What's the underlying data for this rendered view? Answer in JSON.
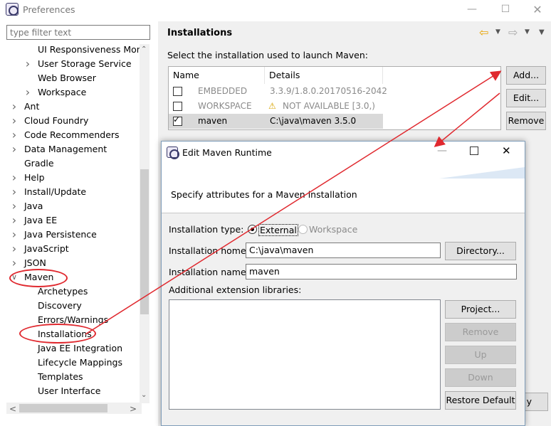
{
  "window": {
    "title": "Preferences"
  },
  "filter": {
    "placeholder": "type filter text"
  },
  "tree": [
    {
      "label": "UI Responsiveness Moni",
      "indent": 2,
      "chevron": ""
    },
    {
      "label": "User Storage Service",
      "indent": 2,
      "chevron": ">"
    },
    {
      "label": "Web Browser",
      "indent": 2,
      "chevron": ""
    },
    {
      "label": "Workspace",
      "indent": 2,
      "chevron": ">"
    },
    {
      "label": "Ant",
      "indent": 1,
      "chevron": ">"
    },
    {
      "label": "Cloud Foundry",
      "indent": 1,
      "chevron": ">"
    },
    {
      "label": "Code Recommenders",
      "indent": 1,
      "chevron": ">"
    },
    {
      "label": "Data Management",
      "indent": 1,
      "chevron": ">"
    },
    {
      "label": "Gradle",
      "indent": 1,
      "chevron": ""
    },
    {
      "label": "Help",
      "indent": 1,
      "chevron": ">"
    },
    {
      "label": "Install/Update",
      "indent": 1,
      "chevron": ">"
    },
    {
      "label": "Java",
      "indent": 1,
      "chevron": ">"
    },
    {
      "label": "Java EE",
      "indent": 1,
      "chevron": ">"
    },
    {
      "label": "Java Persistence",
      "indent": 1,
      "chevron": ">"
    },
    {
      "label": "JavaScript",
      "indent": 1,
      "chevron": ">"
    },
    {
      "label": "JSON",
      "indent": 1,
      "chevron": ">"
    },
    {
      "label": "Maven",
      "indent": 1,
      "chevron": "v"
    },
    {
      "label": "Archetypes",
      "indent": 2,
      "chevron": ""
    },
    {
      "label": "Discovery",
      "indent": 2,
      "chevron": ""
    },
    {
      "label": "Errors/Warnings",
      "indent": 2,
      "chevron": ""
    },
    {
      "label": "Installations",
      "indent": 2,
      "chevron": ""
    },
    {
      "label": "Java EE Integration",
      "indent": 2,
      "chevron": ""
    },
    {
      "label": "Lifecycle Mappings",
      "indent": 2,
      "chevron": ""
    },
    {
      "label": "Templates",
      "indent": 2,
      "chevron": ""
    },
    {
      "label": "User Interface",
      "indent": 2,
      "chevron": ""
    }
  ],
  "installations": {
    "title": "Installations",
    "subtitle": "Select the installation used to launch Maven:",
    "columns": [
      "Name",
      "Details"
    ],
    "rows": [
      {
        "name": "EMBEDDED",
        "details": "3.3.9/1.8.0.20170516-2042",
        "checked": false,
        "dim": true,
        "warn": false
      },
      {
        "name": "WORKSPACE",
        "details": "NOT AVAILABLE [3.0,)",
        "checked": false,
        "dim": true,
        "warn": true
      },
      {
        "name": "maven",
        "details": "C:\\java\\maven 3.5.0",
        "checked": true,
        "dim": false,
        "warn": false
      }
    ],
    "buttons": {
      "add": "Add...",
      "edit": "Edit...",
      "remove": "Remove"
    },
    "partial_button_text": "y"
  },
  "dialog": {
    "title": "Edit Maven Runtime",
    "description": "Specify attributes for a Maven installation",
    "type_label": "Installation type:",
    "type_external": "External",
    "type_workspace": "Workspace",
    "home_label": "Installation home:",
    "home_value": "C:\\java\\maven",
    "directory_button": "Directory...",
    "name_label": "Installation name:",
    "name_value": "maven",
    "ext_label": "Additional extension libraries:",
    "buttons": {
      "project": "Project...",
      "remove": "Remove",
      "up": "Up",
      "down": "Down",
      "restore": "Restore Default"
    }
  },
  "colors": {
    "annotation": "#e0292f",
    "accent_arrow": "#e8a300"
  }
}
